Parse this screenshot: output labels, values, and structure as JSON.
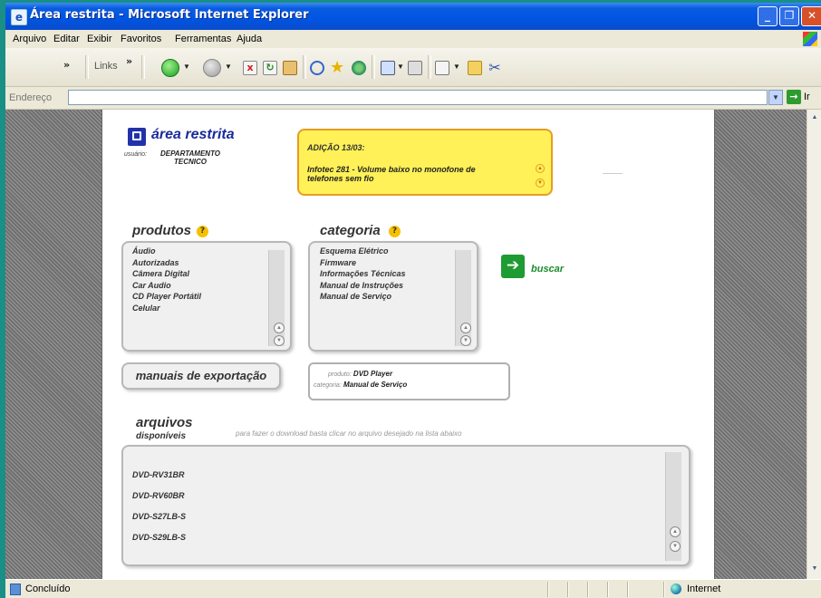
{
  "window": {
    "title": "Área restrita - Microsoft Internet Explorer",
    "icon": "ie-page-icon",
    "controls": [
      "minimize-icon",
      "maximize-icon",
      "close-icon"
    ]
  },
  "menu": [
    "Arquivo",
    "Editar",
    "Exibir",
    "Favoritos",
    "Ferramentas",
    "Ajuda"
  ],
  "toolbar": {
    "links_label": "Links",
    "overflow": "»",
    "buttons": [
      "back-icon",
      "forward-icon",
      "stop-icon",
      "refresh-icon",
      "home-icon",
      "search-icon",
      "favorites-star-icon",
      "history-icon",
      "mail-icon",
      "print-icon",
      "edit-icon",
      "folder-icon",
      "scissors-icon"
    ]
  },
  "address": {
    "label": "Endereço",
    "value": "",
    "go_label": "Ir"
  },
  "page": {
    "header": {
      "title": "área restrita",
      "user_label": "usuário:",
      "user_name": "DEPARTAMENTO TECNICO"
    },
    "news": {
      "heading": "ADIÇÃO 13/03:",
      "text": "Infotec 281 - Volume baixo no monofone de telefones sem fio"
    },
    "produtos": {
      "title": "produtos",
      "items": [
        "Áudio",
        "Autorizadas",
        "Câmera Digital",
        "Car Audio",
        "CD Player Portátil",
        "Celular"
      ]
    },
    "categoria": {
      "title": "categoria",
      "items": [
        "Esquema Elétrico",
        "Firmware",
        "Informações Técnicas",
        "Manual de Instruções",
        "Manual de Serviço"
      ]
    },
    "buscar_label": "buscar",
    "manuais_label": "manuais de exportação",
    "selection": {
      "produto_label": "produto:",
      "produto_value": "DVD Player",
      "categoria_label": "categoria:",
      "categoria_value": "Manual de Serviço"
    },
    "arquivos": {
      "title": "arquivos",
      "subtitle": "disponíveis",
      "hint": "para fazer o download basta clicar no arquivo desejado na lista abaixo",
      "files": [
        "DVD-RV31BR",
        "DVD-RV60BR",
        "DVD-S27LB-S",
        "DVD-S29LB-S"
      ]
    }
  },
  "status": {
    "text": "Concluído",
    "zone": "Internet"
  },
  "colors": {
    "titlebar": "#0054e3",
    "page_title": "#1a2a9a",
    "news_bg": "#fff157",
    "news_border": "#e69d22",
    "buscar": "#1f9b33",
    "help_badge": "#f6c000"
  }
}
